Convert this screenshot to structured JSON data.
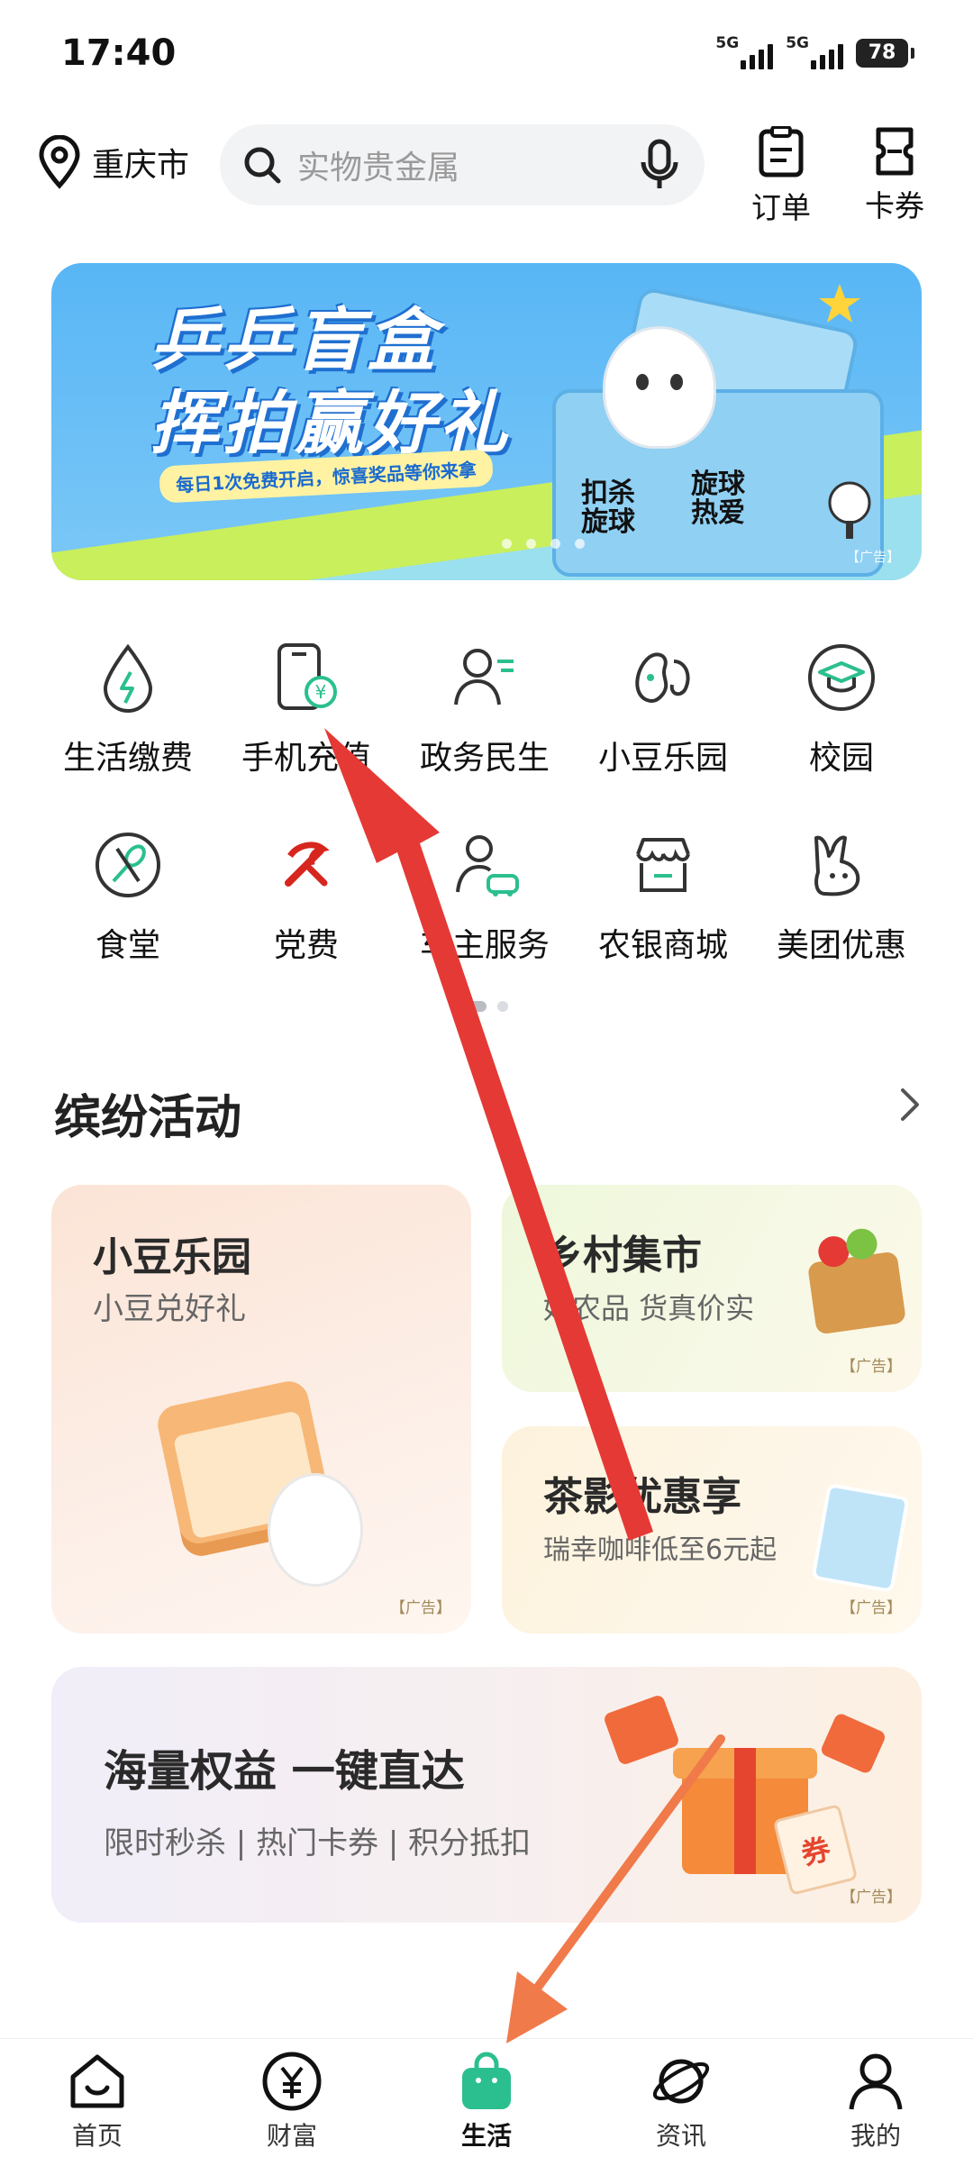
{
  "status": {
    "time": "17:40",
    "net1": "5G",
    "net2": "5G",
    "battery": "78"
  },
  "header": {
    "city": "重庆市",
    "search_placeholder": "实物贵金属",
    "orders_label": "订单",
    "coupons_label": "卡券"
  },
  "banner": {
    "title_line1": "乒乒盲盒",
    "title_line2": "挥拍赢好礼",
    "subtitle": "每日1次免费开启，惊喜奖品等你来拿",
    "box_text1": "扣杀\n旋球",
    "box_text2": "旋球\n热爱",
    "ad": "【广告】"
  },
  "services": [
    {
      "label": "生活缴费",
      "icon": "water-drop-icon"
    },
    {
      "label": "手机充值",
      "icon": "phone-topup-icon"
    },
    {
      "label": "政务民生",
      "icon": "citizen-service-icon"
    },
    {
      "label": "小豆乐园",
      "icon": "bean-icon"
    },
    {
      "label": "校园",
      "icon": "graduation-cap-icon"
    },
    {
      "label": "食堂",
      "icon": "canteen-icon"
    },
    {
      "label": "党费",
      "icon": "party-emblem-icon"
    },
    {
      "label": "车主服务",
      "icon": "car-owner-icon"
    },
    {
      "label": "农银商城",
      "icon": "store-icon"
    },
    {
      "label": "美团优惠",
      "icon": "meituan-icon"
    }
  ],
  "section": {
    "title": "缤纷活动"
  },
  "cards": {
    "xiaodou": {
      "title": "小豆乐园",
      "subtitle": "小豆兑好礼",
      "ad": "【广告】"
    },
    "village": {
      "title": "乡村集市",
      "subtitle": "好农品 货真价实",
      "ad": "【广告】"
    },
    "tea": {
      "title": "茶影优惠享",
      "subtitle": "瑞幸咖啡低至6元起",
      "ad": "【广告】"
    },
    "rights": {
      "title": "海量权益 一键直达",
      "subtitle": "限时秒杀 | 热门卡券 | 积分抵扣",
      "ad": "【广告】",
      "coupon": "券"
    }
  },
  "tabs": [
    {
      "label": "首页",
      "icon": "home-icon"
    },
    {
      "label": "财富",
      "icon": "yen-icon"
    },
    {
      "label": "生活",
      "icon": "shopping-bag-icon"
    },
    {
      "label": "资讯",
      "icon": "planet-icon"
    },
    {
      "label": "我的",
      "icon": "profile-icon"
    }
  ],
  "colors": {
    "accent": "#2bbf8f",
    "arrow_red": "#e53935",
    "arrow_orange": "#f07a4a"
  }
}
